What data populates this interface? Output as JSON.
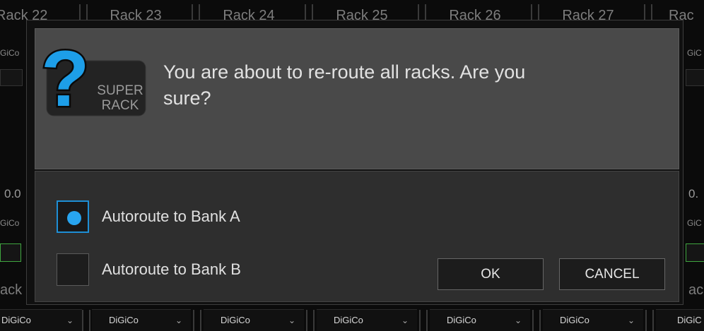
{
  "racks": {
    "headers": [
      "Rack 22",
      "Rack 23",
      "Rack 24",
      "Rack 25",
      "Rack 26",
      "Rack 27",
      "Rac"
    ],
    "footers": [
      "DiGiCo",
      "DiGiCo",
      "DiGiCo",
      "DiGiCo",
      "DiGiCo",
      "DiGiCo",
      "DiGiC"
    ]
  },
  "side_fragments": {
    "left_gico_1": "GiCo",
    "left_value": "0.0",
    "left_gico_2": "GiCo",
    "left_ack": "ack",
    "right_gico_1": "GiC",
    "right_value": "0.",
    "right_gico_2": "GiC",
    "right_ac": "ac"
  },
  "dialog": {
    "logo": {
      "glyph": "?",
      "line1": "SUPER",
      "line2": "RACK"
    },
    "message_line1": "You are about to re-route all racks. Are you",
    "message_line2": "sure?",
    "options": [
      {
        "label": "Autoroute to Bank A",
        "checked": true
      },
      {
        "label": "Autoroute to Bank B",
        "checked": false
      }
    ],
    "ok_label": "OK",
    "cancel_label": "CANCEL"
  },
  "colors": {
    "accent": "#28a5f0",
    "dialog_top": "#494949",
    "dialog_bottom": "#2e2e2e"
  }
}
